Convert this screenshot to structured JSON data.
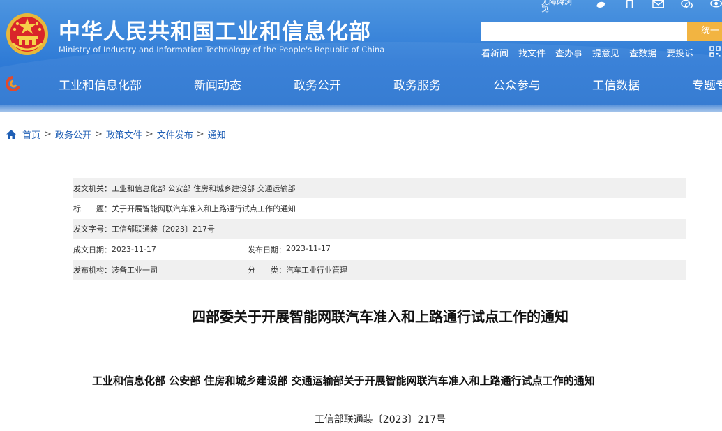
{
  "header": {
    "title_cn": "中华人民共和国工业和信息化部",
    "title_en": "Ministry of Industry and Information Technology of the People's Republic of China",
    "accessibility_label": "无障碍浏览",
    "search": {
      "placeholder": "",
      "button_label": "统一"
    },
    "quick_links": [
      "看新闻",
      "找文件",
      "查办事",
      "提意见",
      "查数据",
      "要投诉"
    ]
  },
  "nav": {
    "items": [
      "工业和信息化部",
      "新闻动态",
      "政务公开",
      "政务服务",
      "公众参与",
      "工信数据",
      "专题专"
    ]
  },
  "breadcrumb": [
    "首页",
    "政务公开",
    "政策文件",
    "文件发布",
    "通知"
  ],
  "info": {
    "issuer_label": "发文机关：",
    "issuer": "工业和信息化部 公安部 住房和城乡建设部 交通运输部",
    "title_label": "标　　题：",
    "title": "关于开展智能网联汽车准入和上路通行试点工作的通知",
    "doc_no_label": "发文字号：",
    "doc_no": "工信部联通装〔2023〕217号",
    "written_label": "成文日期：",
    "written_date": "2023-11-17",
    "published_label": "发布日期：",
    "published_date": "2023-11-17",
    "org_label": "发布机构：",
    "org": "装备工业一司",
    "category_label": "分　　类：",
    "category": "汽车工业行业管理"
  },
  "article": {
    "heading": "四部委关于开展智能网联汽车准入和上路通行试点工作的通知",
    "subheading": "工业和信息化部 公安部 住房和城乡建设部 交通运输部关于开展智能网联汽车准入和上路通行试点工作的通知",
    "doc_number": "工信部联通装〔2023〕217号"
  },
  "colors": {
    "header_blue": "#2f7bd6",
    "search_button": "#f2b441",
    "link_blue": "#1f5fb5",
    "row_shade": "#f0f0f0"
  },
  "icons": [
    "national-emblem-icon",
    "weibo-icon",
    "mobile-icon",
    "mail-icon",
    "wechat-icon",
    "eye-icon",
    "home-icon",
    "nav-logo-icon",
    "qr-icon"
  ]
}
